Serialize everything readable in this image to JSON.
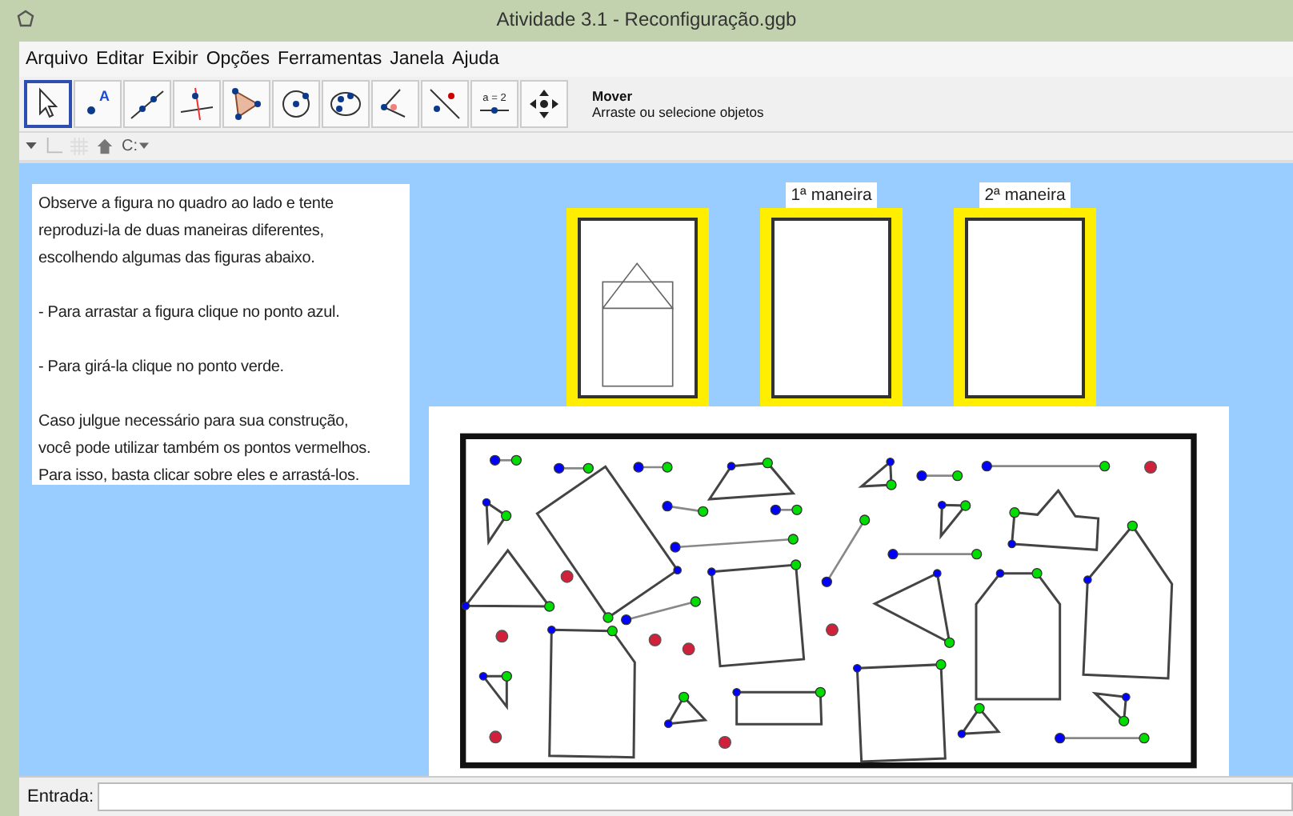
{
  "window": {
    "title": "Atividade 3.1 - Reconfiguração.ggb"
  },
  "menu": [
    "Arquivo",
    "Editar",
    "Exibir",
    "Opções",
    "Ferramentas",
    "Janela",
    "Ajuda"
  ],
  "toolbar": {
    "tools": [
      {
        "kind": "pointer",
        "selected": true
      },
      {
        "kind": "point",
        "label": "A",
        "selected": false
      },
      {
        "kind": "line",
        "selected": false
      },
      {
        "kind": "perpendicular",
        "selected": false
      },
      {
        "kind": "polygon",
        "selected": false
      },
      {
        "kind": "circle",
        "selected": false
      },
      {
        "kind": "conic",
        "selected": false
      },
      {
        "kind": "angle",
        "selected": false
      },
      {
        "kind": "reflect",
        "selected": false
      },
      {
        "kind": "slider",
        "label": "a = 2",
        "selected": false
      },
      {
        "kind": "move-view",
        "selected": false
      }
    ],
    "tool_name": "Mover",
    "tool_help": "Arraste ou selecione objetos"
  },
  "style_bar": {
    "label": "C:"
  },
  "instructions": [
    [
      "Observe a figura no quadro ao lado e tente",
      "reproduzi-la de duas maneiras diferentes,",
      "escolhendo algumas das figuras abaixo."
    ],
    [
      "- Para arrastar a figura clique no ponto azul."
    ],
    [
      "- Para girá-la clique no ponto verde."
    ],
    [
      "Caso julgue necessário para sua construção,",
      "você pode utilizar também os pontos vermelhos.",
      "Para isso, basta clicar sobre eles e arrastá-los."
    ]
  ],
  "frames": [
    {
      "kind": "model"
    },
    {
      "kind": "answer",
      "label": "1ª maneira"
    },
    {
      "kind": "answer",
      "label": "2ª maneira"
    }
  ],
  "input_bar": {
    "label": "Entrada:"
  }
}
